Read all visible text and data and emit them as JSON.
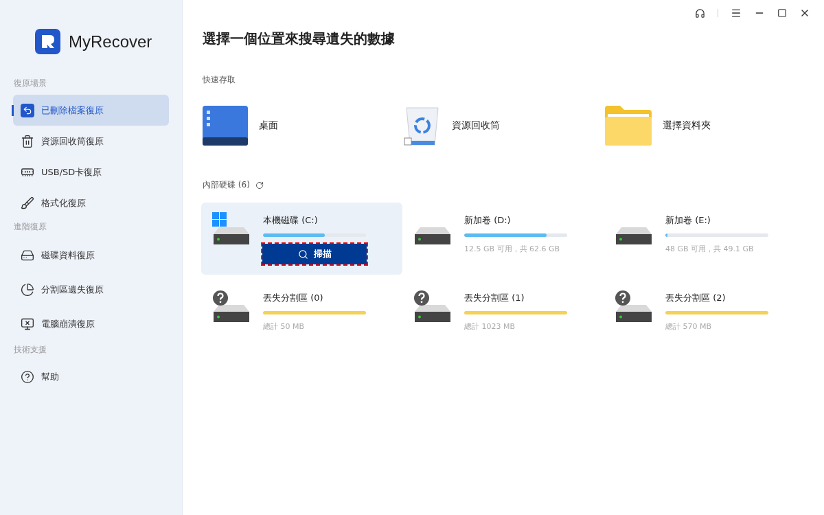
{
  "app": {
    "name": "MyRecover"
  },
  "sidebar": {
    "sections": [
      {
        "heading": "復原場景",
        "items": [
          {
            "label": "已刪除檔案復原",
            "selected": true
          },
          {
            "label": "資源回收筒復原",
            "selected": false
          },
          {
            "label": "USB/SD卡復原",
            "selected": false
          },
          {
            "label": "格式化復原",
            "selected": false
          }
        ]
      },
      {
        "heading": "進階復原",
        "items": [
          {
            "label": "磁碟資料復原",
            "selected": false
          },
          {
            "label": "分割區遺失復原",
            "selected": false
          },
          {
            "label": "電腦崩潰復原",
            "selected": false
          }
        ]
      },
      {
        "heading": "技術支援",
        "items": [
          {
            "label": "幫助",
            "selected": false
          }
        ]
      }
    ]
  },
  "main": {
    "title": "選擇一個位置來搜尋遺失的數據",
    "quick_access": {
      "heading": "快速存取",
      "items": [
        {
          "kind": "desktop",
          "label": "桌面"
        },
        {
          "kind": "recycle",
          "label": "資源回收筒"
        },
        {
          "kind": "folder",
          "label": "選擇資料夾"
        }
      ]
    },
    "drives": {
      "heading": "內部硬碟 (6)",
      "items": [
        {
          "kind": "system",
          "name": "本機磁碟 (C:)",
          "level": 0.6,
          "selected": true,
          "button": "掃描"
        },
        {
          "kind": "volume",
          "name": "新加卷 (D:)",
          "level": 0.8,
          "selected": false,
          "caption": "12.5 GB 可用，共 62.6 GB"
        },
        {
          "kind": "volume",
          "name": "新加卷 (E:)",
          "level": 0.02,
          "selected": false,
          "caption": "48 GB 可用，共 49.1 GB"
        },
        {
          "kind": "lost",
          "name": "丟失分割區 (0)",
          "level": 1,
          "selected": false,
          "caption": "總計 50 MB"
        },
        {
          "kind": "lost",
          "name": "丟失分割區 (1)",
          "level": 1,
          "selected": false,
          "caption": "總計 1023 MB"
        },
        {
          "kind": "lost",
          "name": "丟失分割區 (2)",
          "level": 1,
          "selected": false,
          "caption": "總計 570 MB"
        }
      ]
    }
  }
}
